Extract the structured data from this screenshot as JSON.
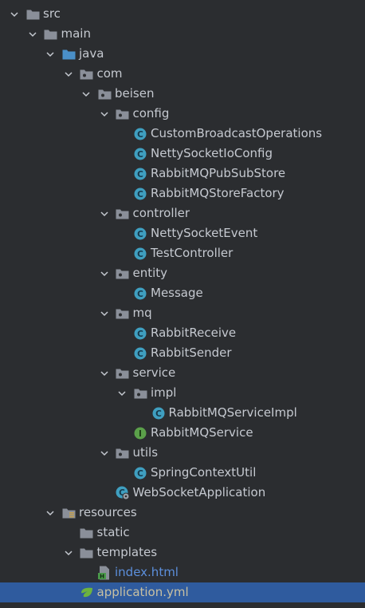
{
  "tree": [
    {
      "label": "src",
      "depth": 0,
      "expanded": true,
      "icon": "folder-icon"
    },
    {
      "label": "main",
      "depth": 1,
      "expanded": true,
      "icon": "folder-icon"
    },
    {
      "label": "java",
      "depth": 2,
      "expanded": true,
      "icon": "source-folder-icon"
    },
    {
      "label": "com",
      "depth": 3,
      "expanded": true,
      "icon": "package-icon"
    },
    {
      "label": "beisen",
      "depth": 4,
      "expanded": true,
      "icon": "package-icon"
    },
    {
      "label": "config",
      "depth": 5,
      "expanded": true,
      "icon": "package-icon"
    },
    {
      "label": "CustomBroadcastOperations",
      "depth": 6,
      "icon": "class-icon"
    },
    {
      "label": "NettySocketIoConfig",
      "depth": 6,
      "icon": "class-icon"
    },
    {
      "label": "RabbitMQPubSubStore",
      "depth": 6,
      "icon": "class-icon"
    },
    {
      "label": "RabbitMQStoreFactory",
      "depth": 6,
      "icon": "class-icon"
    },
    {
      "label": "controller",
      "depth": 5,
      "expanded": true,
      "icon": "package-icon"
    },
    {
      "label": "NettySocketEvent",
      "depth": 6,
      "icon": "class-icon"
    },
    {
      "label": "TestController",
      "depth": 6,
      "icon": "class-icon"
    },
    {
      "label": "entity",
      "depth": 5,
      "expanded": true,
      "icon": "package-icon"
    },
    {
      "label": "Message",
      "depth": 6,
      "icon": "class-icon"
    },
    {
      "label": "mq",
      "depth": 5,
      "expanded": true,
      "icon": "package-icon"
    },
    {
      "label": "RabbitReceive",
      "depth": 6,
      "icon": "class-icon"
    },
    {
      "label": "RabbitSender",
      "depth": 6,
      "icon": "class-icon"
    },
    {
      "label": "service",
      "depth": 5,
      "expanded": true,
      "icon": "package-icon"
    },
    {
      "label": "impl",
      "depth": 6,
      "expanded": true,
      "icon": "package-icon"
    },
    {
      "label": "RabbitMQServiceImpl",
      "depth": 7,
      "icon": "class-icon"
    },
    {
      "label": "RabbitMQService",
      "depth": 6,
      "icon": "interface-icon"
    },
    {
      "label": "utils",
      "depth": 5,
      "expanded": true,
      "icon": "package-icon"
    },
    {
      "label": "SpringContextUtil",
      "depth": 6,
      "icon": "class-icon"
    },
    {
      "label": "WebSocketApplication",
      "depth": 5,
      "icon": "spring-app-icon"
    },
    {
      "label": "resources",
      "depth": 2,
      "expanded": true,
      "icon": "resources-folder-icon"
    },
    {
      "label": "static",
      "depth": 3,
      "icon": "folder-icon"
    },
    {
      "label": "templates",
      "depth": 3,
      "expanded": true,
      "icon": "folder-icon"
    },
    {
      "label": "index.html",
      "depth": 4,
      "icon": "html-file-icon",
      "style": "link"
    },
    {
      "label": "application.yml",
      "depth": 3,
      "icon": "yml-file-icon",
      "style": "yellow",
      "selected": true
    }
  ],
  "colors": {
    "background": "#2b2d30",
    "selection": "#2f5b9e",
    "text": "#c5c9d0",
    "link": "#5c8fdc",
    "class_icon": "#3f9fc0",
    "interface_icon": "#5ba04a",
    "folder": "#8a8f99",
    "source_folder": "#4a8fc8"
  }
}
